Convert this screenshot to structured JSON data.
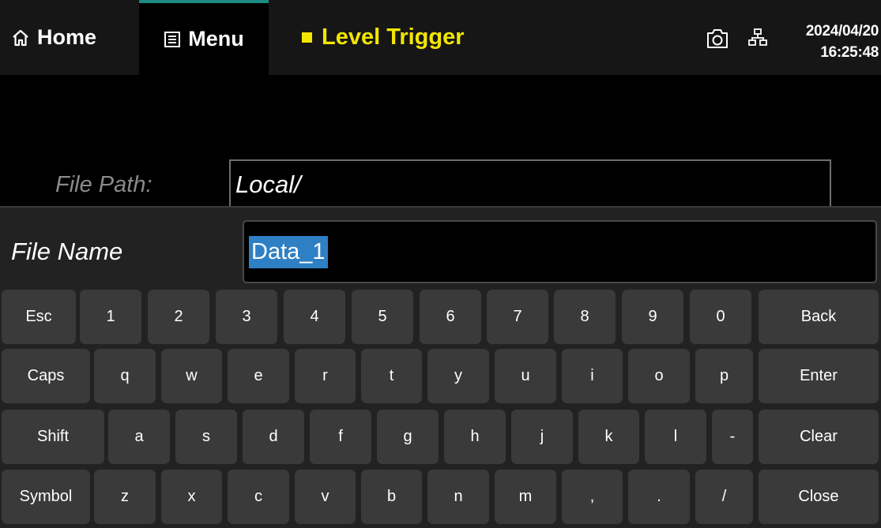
{
  "header": {
    "home_label": "Home",
    "menu_label": "Menu",
    "title": "Level Trigger",
    "date": "2024/04/20",
    "time": "16:25:48"
  },
  "file": {
    "path_label": "File Path:",
    "path_value": "Local/",
    "name_label": "File Name",
    "name_value": "Data_1"
  },
  "keyboard": {
    "rows": [
      [
        "Esc",
        "1",
        "2",
        "3",
        "4",
        "5",
        "6",
        "7",
        "8",
        "9",
        "0",
        "Back"
      ],
      [
        "Caps",
        "q",
        "w",
        "e",
        "r",
        "t",
        "y",
        "u",
        "i",
        "o",
        "p",
        "Enter"
      ],
      [
        "Shift",
        "a",
        "s",
        "d",
        "f",
        "g",
        "h",
        "j",
        "k",
        "l",
        "-",
        "Clear"
      ],
      [
        "Symbol",
        "z",
        "x",
        "c",
        "v",
        "b",
        "n",
        "m",
        ",",
        ".",
        "/",
        "Close"
      ]
    ]
  },
  "colors": {
    "title": "#f2e600",
    "selection": "#2f7fc4",
    "key": "#3a3a3a",
    "menu_accent": "#1e8a82"
  }
}
